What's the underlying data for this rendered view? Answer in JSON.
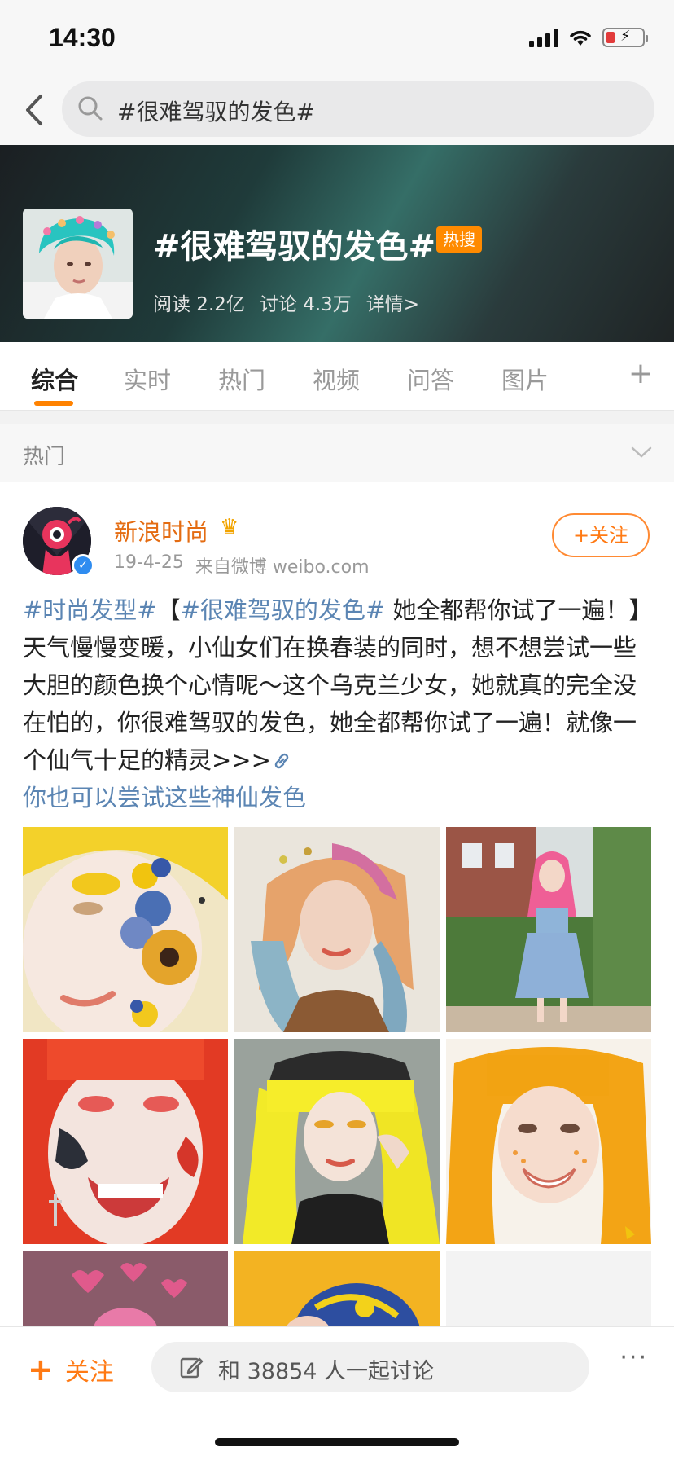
{
  "status_bar": {
    "time": "14:30",
    "battery_color": "#e23b3b"
  },
  "search": {
    "query": "#很难驾驭的发色#",
    "icon": "search-icon"
  },
  "topic": {
    "title": "#很难驾驭的发色#",
    "badge": "热搜",
    "reads": "阅读 2.2亿",
    "discussions": "讨论 4.3万",
    "details": "详情>"
  },
  "tabs": [
    "综合",
    "实时",
    "热门",
    "视频",
    "问答",
    "图片"
  ],
  "tab_more": "+",
  "section": {
    "label": "热门"
  },
  "post": {
    "author": "新浪时尚",
    "date": "19-4-25",
    "source": "来自微博 weibo.com",
    "follow": "+关注",
    "tag1": "#时尚发型#",
    "bracket_open": "【",
    "tag2": "#很难驾驭的发色#",
    "text": " 她全都帮你试了一遍！】天气慢慢变暖，小仙女们在换春装的同时，想不想尝试一些大胆的颜色换个心情呢～这个乌克兰少女，她就真的完全没在怕的，你很难驾驭的发色，她全都帮你试了一遍！就像一个仙气十足的精灵>>>",
    "link": "你也可以尝试这些神仙发色"
  },
  "bottom_bar": {
    "follow": "关注",
    "discuss": "和 38854 人一起讨论",
    "more": "···"
  },
  "colors": {
    "accent": "#ff8200",
    "link": "#5b85b3",
    "author": "#e46c12"
  }
}
